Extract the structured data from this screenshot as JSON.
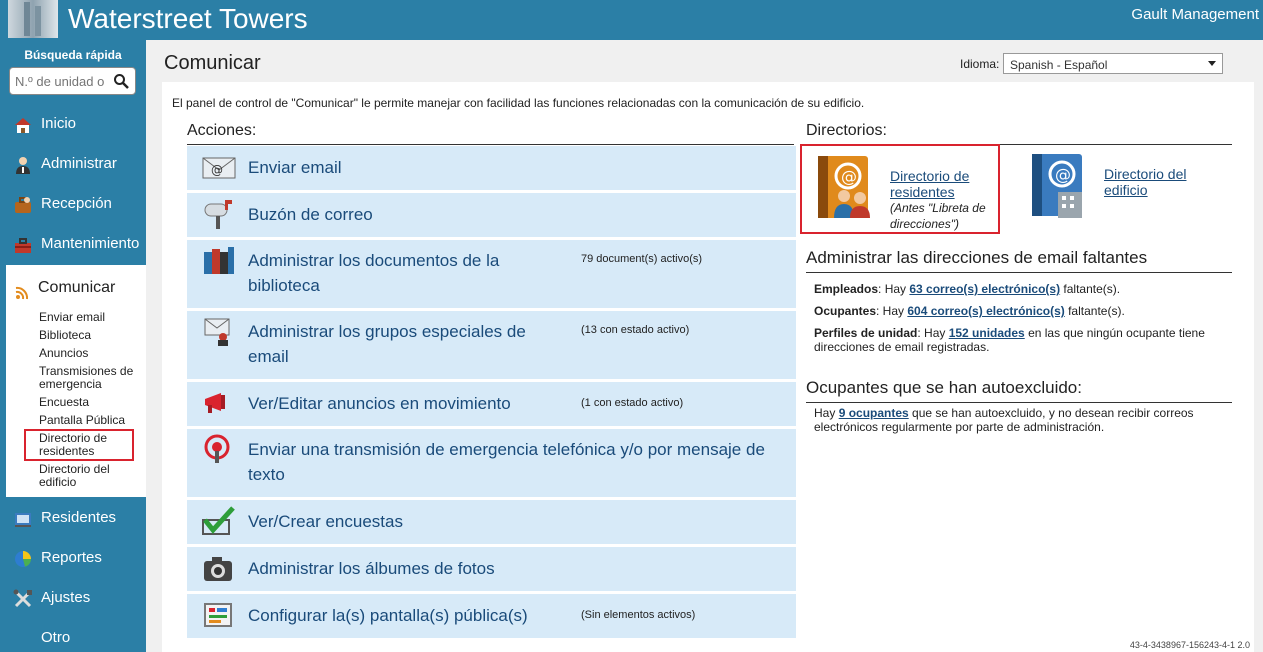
{
  "header": {
    "brand": "Waterstreet Towers",
    "management": "Gault Management"
  },
  "sidebar": {
    "quick_search_label": "Búsqueda rápida",
    "quick_search_placeholder": "N.º de unidad o",
    "items": [
      {
        "label": "Inicio",
        "icon": "home-icon"
      },
      {
        "label": "Administrar",
        "icon": "admin-user-icon"
      },
      {
        "label": "Recepción",
        "icon": "briefcase-icon"
      },
      {
        "label": "Mantenimiento",
        "icon": "toolbox-icon"
      },
      {
        "label": "Comunicar",
        "icon": "wifi-signal-icon"
      },
      {
        "label": "Residentes",
        "icon": "residents-icon"
      },
      {
        "label": "Reportes",
        "icon": "pie-chart-icon"
      },
      {
        "label": "Ajustes",
        "icon": "tools-icon"
      },
      {
        "label": "Otro",
        "icon": ""
      }
    ],
    "comm_sub": [
      "Enviar email",
      "Biblioteca",
      "Anuncios",
      "Transmisiones de emergencia",
      "Encuesta",
      "Pantalla Pública",
      "Directorio de residentes",
      "Directorio del edificio"
    ]
  },
  "main": {
    "title": "Comunicar",
    "language_label": "Idioma:",
    "language_value": "Spanish - Español",
    "intro": "El panel de control de \"Comunicar\" le permite manejar con facilidad las funciones relacionadas con la comunicación de su edificio.",
    "actions_title": "Acciones:",
    "actions": [
      {
        "label": "Enviar email",
        "status": "",
        "icon": "email-icon"
      },
      {
        "label": "Buzón de correo",
        "status": "",
        "icon": "mailbox-icon"
      },
      {
        "label": "Administrar los documentos de la biblioteca",
        "status": "79 document(s) activo(s)",
        "icon": "books-icon"
      },
      {
        "label": "Administrar los grupos especiales de email",
        "status": "(13 con estado activo)",
        "icon": "group-email-icon"
      },
      {
        "label": "Ver/Editar anuncios en movimiento",
        "status": "(1 con estado activo)",
        "icon": "megaphone-icon"
      },
      {
        "label": "Enviar una transmisión de emergencia telefónica y/o por mensaje de texto",
        "status": "",
        "icon": "emergency-phone-icon"
      },
      {
        "label": "Ver/Crear encuestas",
        "status": "",
        "icon": "checkmark-icon"
      },
      {
        "label": "Administrar los álbumes de fotos",
        "status": "",
        "icon": "camera-icon"
      },
      {
        "label": "Configurar la(s) pantalla(s) pública(s)",
        "status": "(Sin elementos activos)",
        "icon": "public-screen-icon"
      }
    ],
    "directories_title": "Directorios:",
    "dir_residents": {
      "line1": "Directorio de",
      "line2": "residentes",
      "note1": "(Antes \"Libreta de",
      "note2": "direcciones\")"
    },
    "dir_building": {
      "line1": "Directorio del",
      "line2": "edificio"
    },
    "missing_title": "Administrar las direcciones de email faltantes",
    "missing": {
      "employees_label": "Empleados",
      "employees_pre": ": Hay ",
      "employees_link": "63 correo(s) electrónico(s)",
      "employees_post": " faltante(s).",
      "occupants_label": "Ocupantes",
      "occupants_pre": ": Hay ",
      "occupants_link": "604 correo(s) electrónico(s)",
      "occupants_post": " faltante(s).",
      "profiles_label": "Perfiles de unidad",
      "profiles_pre": ": Hay ",
      "profiles_link": "152 unidades",
      "profiles_post": " en las que ningún ocupante tiene direcciones de email registradas."
    },
    "optout_title": "Ocupantes que se han autoexcluido:",
    "optout": {
      "pre": "Hay ",
      "link": "9 ocupantes",
      "post": " que se han autoexcluido, y no desean recibir correos electrónicos regularmente por parte de administración."
    },
    "version": "43-4-3438967-156243-4-1 2.0"
  }
}
